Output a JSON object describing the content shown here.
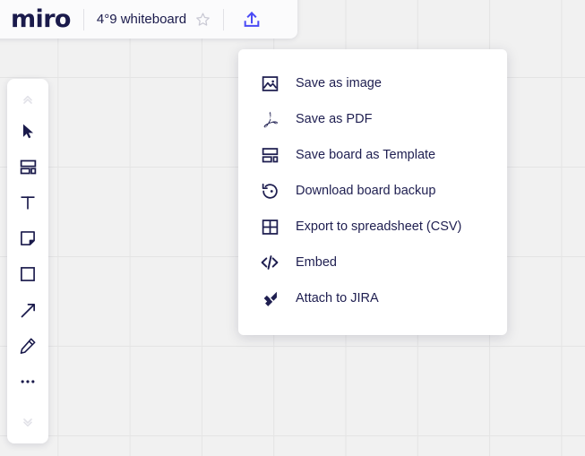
{
  "colors": {
    "canvas_bg": "#f1f1f1",
    "grid_line": "#e4e4e4",
    "brand_dark": "#1a1a4b",
    "accent_indigo": "#4b4bf5",
    "panel_white": "#ffffff",
    "star_gray": "#c9c9d4",
    "chevron_gray": "#e2e2e8"
  },
  "header": {
    "logo": "miro",
    "board_title": "4°9 whiteboard",
    "star_icon": "star-icon",
    "upload_icon": "upload-icon"
  },
  "toolbar": {
    "items": [
      {
        "name": "collapse-up-chevron-icon",
        "label": "Collapse"
      },
      {
        "name": "cursor-select-icon",
        "label": "Select"
      },
      {
        "name": "frame-icon",
        "label": "Frame"
      },
      {
        "name": "text-icon",
        "label": "Text"
      },
      {
        "name": "sticky-note-icon",
        "label": "Sticky note"
      },
      {
        "name": "shape-square-icon",
        "label": "Shape"
      },
      {
        "name": "arrow-connector-icon",
        "label": "Connection line"
      },
      {
        "name": "pen-icon",
        "label": "Pen"
      },
      {
        "name": "more-options-icon",
        "label": "More"
      },
      {
        "name": "expand-down-chevron-icon",
        "label": "More tools"
      }
    ]
  },
  "menu": {
    "items": [
      {
        "icon": "image-icon",
        "label": "Save as image"
      },
      {
        "icon": "pdf-icon",
        "label": "Save as PDF"
      },
      {
        "icon": "template-icon",
        "label": "Save board as Template"
      },
      {
        "icon": "backup-restore-icon",
        "label": "Download board backup"
      },
      {
        "icon": "spreadsheet-grid-icon",
        "label": "Export to spreadsheet (CSV)"
      },
      {
        "icon": "code-embed-icon",
        "label": "Embed"
      },
      {
        "icon": "jira-icon",
        "label": "Attach to JIRA"
      }
    ]
  }
}
